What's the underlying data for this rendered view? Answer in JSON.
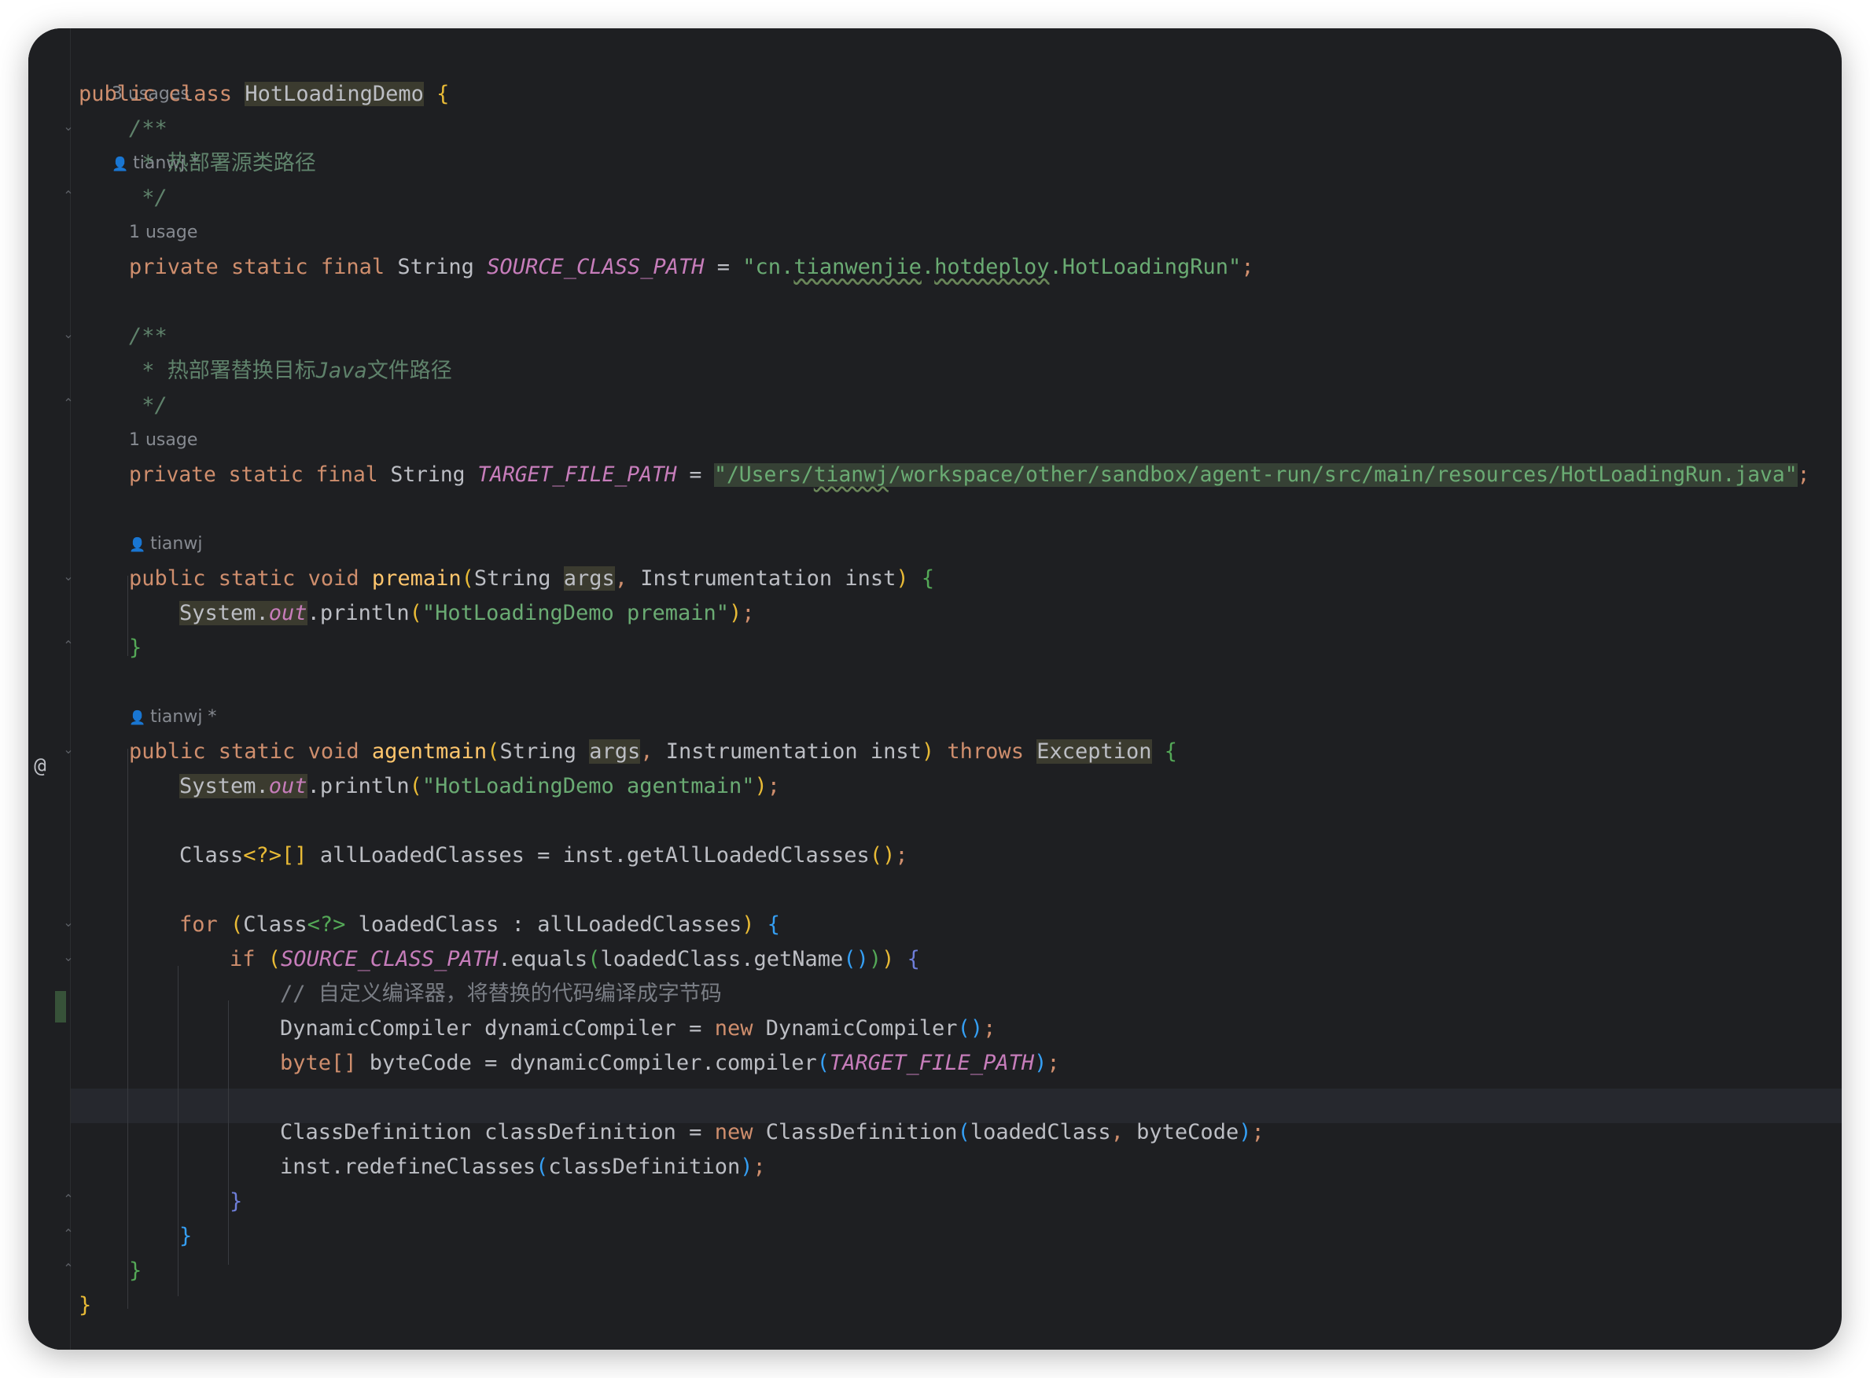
{
  "editor": {
    "class_hints": {
      "usages": "3 usages",
      "author": "tianwj *"
    },
    "decl_class": {
      "kw": "public class ",
      "name": "HotLoadingDemo",
      "brace": " {"
    },
    "doc1": {
      "open": "/**",
      "body": " * 热部署源类路径",
      "close": " */"
    },
    "field1": {
      "usage": "1 usage",
      "kw": "private static final ",
      "type": "String ",
      "name": "SOURCE_CLASS_PATH",
      "eq": " = ",
      "str_a": "\"cn.",
      "str_b": "tianwenjie",
      "str_c": ".",
      "str_d": "hotdeploy",
      "str_e": ".HotLoadingRun\"",
      "semi": ";"
    },
    "doc2": {
      "open": "/**",
      "body_a": " * 热部署替换目标",
      "body_b": "Java",
      "body_c": "文件路径",
      "close": " */"
    },
    "field2": {
      "usage": "1 usage",
      "kw": "private static final ",
      "type": "String ",
      "name": "TARGET_FILE_PATH",
      "eq": " = ",
      "str_a": "\"/Users/",
      "str_b": "tianwj",
      "str_c": "/workspace/other/sandbox/agent-run/src/main/resources/HotLoadingRun.java\"",
      "semi": ";"
    },
    "premain": {
      "author": "tianwj",
      "kw": "public static void ",
      "name": "premain",
      "paren_open": "(",
      "p1_type": "String ",
      "p1_name": "args",
      "comma": ", ",
      "p2": "Instrumentation inst",
      "paren_close": ")",
      "brace": " {",
      "body_sys": "System.",
      "body_out": "out",
      "body_call": ".println",
      "body_po": "(",
      "body_str": "\"HotLoadingDemo premain\"",
      "body_pc": ")",
      "body_semi": ";",
      "close": "}"
    },
    "agentmain": {
      "author": "tianwj *",
      "kw": "public static void ",
      "name": "agentmain",
      "paren_open": "(",
      "p1_type": "String ",
      "p1_name": "args",
      "comma": ", ",
      "p2": "Instrumentation inst",
      "paren_close": ")",
      "throws": " throws ",
      "exc": "Exception",
      "brace": " {",
      "l1_sys": "System.",
      "l1_out": "out",
      "l1_call": ".println",
      "l1_po": "(",
      "l1_str": "\"HotLoadingDemo agentmain\"",
      "l1_pc": ")",
      "l1_semi": ";",
      "l2_a": "Class",
      "l2_b": "<?>[]",
      "l2_c": " allLoadedClasses = inst.getAllLoadedClasses",
      "l2_d": "()",
      "l2_e": ";",
      "l3_kw": "for ",
      "l3_po": "(",
      "l3_a": "Class",
      "l3_b": "<?>",
      "l3_c": " loadedClass : allLoadedClasses",
      "l3_pc": ")",
      "l3_brace": " {",
      "l4_kw": "if ",
      "l4_po": "(",
      "l4_const": "SOURCE_CLASS_PATH",
      "l4_a": ".equals",
      "l4_p2o": "(",
      "l4_b": "loadedClass.getName",
      "l4_p3": "()",
      "l4_p2c": ")",
      "l4_pc": ")",
      "l4_brace": " {",
      "l5_cmt": "// 自定义编译器，将替换的代码编译成字节码",
      "l6_a": "DynamicCompiler dynamicCompiler = ",
      "l6_kw": "new",
      "l6_b": " DynamicCompiler",
      "l6_p": "()",
      "l6_semi": ";",
      "l7_kw": "byte",
      "l7_br": "[]",
      "l7_a": " byteCode = dynamicCompiler.compiler",
      "l7_po": "(",
      "l7_const": "TARGET_FILE_PATH",
      "l7_pc": ")",
      "l7_semi": ";",
      "l8_a": "ClassDefinition classDefinition = ",
      "l8_kw": "new",
      "l8_b": " ClassDefinition",
      "l8_po": "(",
      "l8_c": "loadedClass",
      "l8_comma": ", ",
      "l8_d": "byteCode",
      "l8_pc": ")",
      "l8_semi": ";",
      "l9_a": "inst.redefineClasses",
      "l9_po": "(",
      "l9_b": "classDefinition",
      "l9_pc": ")",
      "l9_semi": ";",
      "close_if": "}",
      "close_for": "}",
      "close_method": "}"
    },
    "close_class": "}",
    "gutter_at": "@"
  },
  "colors": {
    "background": "#1e1f22",
    "keyword": "#cf8e6d",
    "string": "#6aab73",
    "constant": "#c77dbb",
    "doc_comment": "#5f826b",
    "comment": "#7a7e85",
    "method_decl": "#ffc66d"
  }
}
